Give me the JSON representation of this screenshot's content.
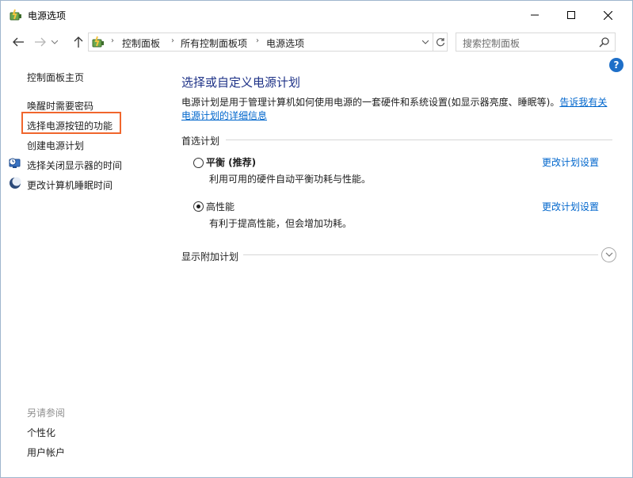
{
  "window": {
    "title": "电源选项",
    "icon": "power-options-icon"
  },
  "nav": {
    "breadcrumbs": [
      "控制面板",
      "所有控制面板项",
      "电源选项"
    ],
    "search_placeholder": "搜索控制面板"
  },
  "sidebar": {
    "home": "控制面板主页",
    "items": [
      {
        "label": "唤醒时需要密码",
        "icon": null
      },
      {
        "label": "选择电源按钮的功能",
        "icon": null,
        "highlighted": true
      },
      {
        "label": "创建电源计划",
        "icon": null
      },
      {
        "label": "选择关闭显示器的时间",
        "icon": "display-schedule-icon"
      },
      {
        "label": "更改计算机睡眠时间",
        "icon": "moon-sleep-icon"
      }
    ],
    "see_also": {
      "heading": "另请参阅",
      "links": [
        "个性化",
        "用户帐户"
      ]
    }
  },
  "main": {
    "title": "选择或自定义电源计划",
    "description": "电源计划是用于管理计算机如何使用电源的一套硬件和系统设置(如显示器亮度、睡眠等)。",
    "description_link": "告诉我有关电源计划的详细信息",
    "preferred_heading": "首选计划",
    "plans": [
      {
        "name": "平衡 (推荐)",
        "desc": "利用可用的硬件自动平衡功耗与性能。",
        "selected": false,
        "link": "更改计划设置"
      },
      {
        "name": "高性能",
        "desc": "有利于提高性能，但会增加功耗。",
        "selected": true,
        "link": "更改计划设置"
      }
    ],
    "more_plans": "显示附加计划"
  },
  "colors": {
    "title_blue": "#1e3287",
    "link_blue": "#0066cc",
    "highlight_orange": "#f0662d"
  }
}
